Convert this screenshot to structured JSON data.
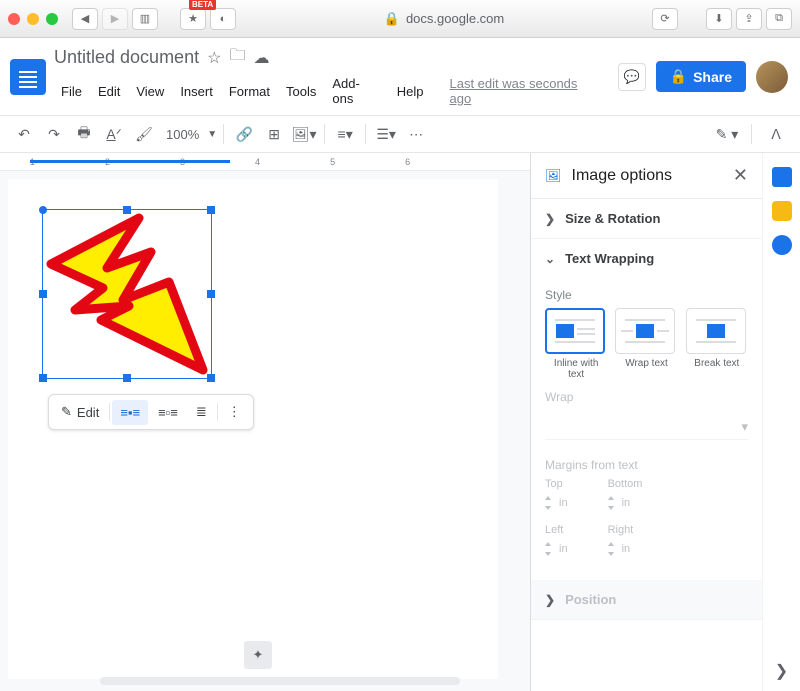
{
  "browser": {
    "url": "docs.google.com",
    "beta": "BETA"
  },
  "doc": {
    "title": "Untitled document",
    "menus": [
      "File",
      "Edit",
      "View",
      "Insert",
      "Format",
      "Tools",
      "Add-ons",
      "Help"
    ],
    "editStamp": "Last edit was seconds ago",
    "shareLabel": "Share",
    "zoom": "100%"
  },
  "ctx": {
    "edit": "Edit"
  },
  "sidebar": {
    "title": "Image options",
    "size": "Size & Rotation",
    "wrapping": "Text Wrapping",
    "styleLabel": "Style",
    "styles": [
      "Inline with text",
      "Wrap text",
      "Break text"
    ],
    "wrapLabel": "Wrap",
    "marginsLabel": "Margins from text",
    "margins": {
      "top": "Top",
      "bottom": "Bottom",
      "left": "Left",
      "right": "Right",
      "unit": "in"
    },
    "position": "Position"
  },
  "ruler": [
    "1",
    "2",
    "3",
    "4",
    "5",
    "6"
  ]
}
